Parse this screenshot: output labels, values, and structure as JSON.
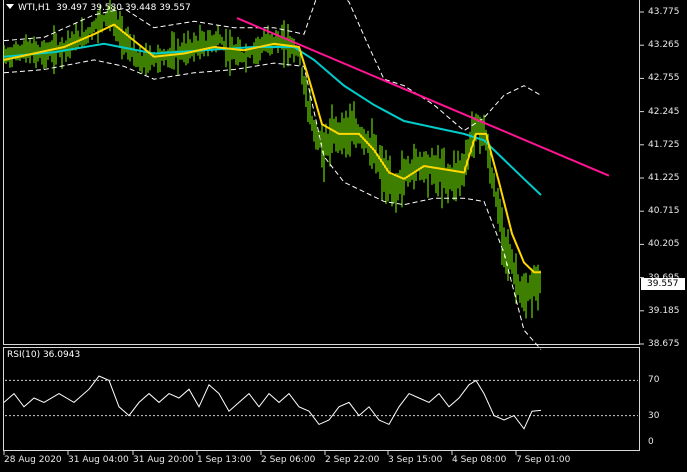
{
  "chart": {
    "symbol": "WTI,H1",
    "ohlc": "39.497 39.580 39.448 39.557",
    "current_price": "39.557",
    "price_ticks": [
      "43.775",
      "43.265",
      "42.755",
      "42.245",
      "41.725",
      "41.225",
      "40.715",
      "40.205",
      "39.695",
      "39.185",
      "38.675"
    ],
    "time_ticks": [
      "28 Aug 2020",
      "31 Aug 04:00",
      "31 Aug 20:00",
      "1 Sep 13:00",
      "2 Sep 06:00",
      "2 Sep 22:00",
      "3 Sep 15:00",
      "4 Sep 08:00",
      "7 Sep 01:00"
    ],
    "colors": {
      "background": "#000000",
      "candles": "#7cfc00",
      "ma_fast": "#ffd700",
      "ma_slow": "#00cccc",
      "envelope": "#ffffff",
      "trendline": "#ff1493",
      "rsi": "#ffffff"
    }
  },
  "rsi": {
    "title": "RSI(10) 36.0943",
    "levels": [
      "70",
      "30",
      "0"
    ]
  },
  "chart_data": {
    "type": "line",
    "title": "WTI,H1 39.497 39.580 39.448 39.557",
    "x_ticks": [
      "28 Aug 2020",
      "31 Aug 04:00",
      "31 Aug 20:00",
      "1 Sep 13:00",
      "2 Sep 06:00",
      "2 Sep 22:00",
      "3 Sep 15:00",
      "4 Sep 08:00",
      "7 Sep 01:00"
    ],
    "ylim": [
      38.6,
      43.9
    ],
    "series": [
      {
        "role": "price",
        "points": [
          [
            0,
            43.05
          ],
          [
            20,
            43.15
          ],
          [
            40,
            43.1
          ],
          [
            60,
            43.2
          ],
          [
            80,
            43.35
          ],
          [
            95,
            43.6
          ],
          [
            105,
            43.7
          ],
          [
            115,
            43.45
          ],
          [
            125,
            43.2
          ],
          [
            135,
            42.95
          ],
          [
            145,
            43.0
          ],
          [
            160,
            43.05
          ],
          [
            175,
            43.1
          ],
          [
            190,
            43.2
          ],
          [
            205,
            43.25
          ],
          [
            215,
            43.35
          ],
          [
            225,
            43.1
          ],
          [
            240,
            43.05
          ],
          [
            255,
            43.2
          ],
          [
            270,
            43.3
          ],
          [
            285,
            43.25
          ],
          [
            295,
            43.1
          ],
          [
            302,
            42.4
          ],
          [
            310,
            41.9
          ],
          [
            320,
            41.6
          ],
          [
            330,
            41.85
          ],
          [
            345,
            41.9
          ],
          [
            360,
            41.8
          ],
          [
            370,
            41.55
          ],
          [
            380,
            41.2
          ],
          [
            390,
            40.95
          ],
          [
            400,
            41.2
          ],
          [
            415,
            41.4
          ],
          [
            430,
            41.3
          ],
          [
            445,
            41.15
          ],
          [
            460,
            41.3
          ],
          [
            470,
            41.95
          ],
          [
            480,
            41.9
          ],
          [
            490,
            41.0
          ],
          [
            500,
            40.2
          ],
          [
            510,
            39.7
          ],
          [
            520,
            39.25
          ],
          [
            530,
            39.5
          ],
          [
            537,
            39.56
          ]
        ]
      },
      {
        "role": "fast-ma",
        "points": [
          [
            0,
            43.0
          ],
          [
            30,
            43.1
          ],
          [
            60,
            43.2
          ],
          [
            90,
            43.4
          ],
          [
            110,
            43.55
          ],
          [
            130,
            43.3
          ],
          [
            150,
            43.05
          ],
          [
            180,
            43.1
          ],
          [
            210,
            43.2
          ],
          [
            240,
            43.15
          ],
          [
            270,
            43.25
          ],
          [
            295,
            43.2
          ],
          [
            305,
            42.7
          ],
          [
            318,
            42.0
          ],
          [
            335,
            41.85
          ],
          [
            355,
            41.85
          ],
          [
            370,
            41.6
          ],
          [
            385,
            41.25
          ],
          [
            400,
            41.15
          ],
          [
            420,
            41.35
          ],
          [
            440,
            41.3
          ],
          [
            460,
            41.25
          ],
          [
            472,
            41.85
          ],
          [
            482,
            41.85
          ],
          [
            495,
            41.1
          ],
          [
            508,
            40.3
          ],
          [
            520,
            39.85
          ],
          [
            530,
            39.7
          ],
          [
            537,
            39.7
          ]
        ]
      },
      {
        "role": "slow-ma",
        "points": [
          [
            0,
            43.05
          ],
          [
            50,
            43.12
          ],
          [
            100,
            43.25
          ],
          [
            150,
            43.1
          ],
          [
            200,
            43.15
          ],
          [
            250,
            43.2
          ],
          [
            290,
            43.2
          ],
          [
            310,
            43.0
          ],
          [
            340,
            42.6
          ],
          [
            370,
            42.3
          ],
          [
            400,
            42.05
          ],
          [
            430,
            41.95
          ],
          [
            460,
            41.85
          ],
          [
            480,
            41.75
          ],
          [
            500,
            41.45
          ],
          [
            520,
            41.15
          ],
          [
            537,
            40.9
          ]
        ]
      },
      {
        "role": "envelope-upper",
        "points": [
          [
            0,
            43.3
          ],
          [
            40,
            43.35
          ],
          [
            90,
            43.7
          ],
          [
            120,
            43.8
          ],
          [
            150,
            43.5
          ],
          [
            190,
            43.6
          ],
          [
            230,
            43.5
          ],
          [
            270,
            43.5
          ],
          [
            300,
            43.4
          ],
          [
            320,
            44.3
          ],
          [
            345,
            43.9
          ],
          [
            365,
            43.2
          ],
          [
            380,
            42.7
          ],
          [
            400,
            42.6
          ],
          [
            430,
            42.3
          ],
          [
            460,
            41.9
          ],
          [
            480,
            42.1
          ],
          [
            500,
            42.45
          ],
          [
            520,
            42.6
          ],
          [
            537,
            42.45
          ]
        ]
      },
      {
        "role": "envelope-lower",
        "points": [
          [
            0,
            42.8
          ],
          [
            40,
            42.85
          ],
          [
            90,
            43.0
          ],
          [
            120,
            42.9
          ],
          [
            150,
            42.7
          ],
          [
            190,
            42.8
          ],
          [
            230,
            42.85
          ],
          [
            270,
            42.95
          ],
          [
            300,
            42.9
          ],
          [
            320,
            41.5
          ],
          [
            340,
            41.1
          ],
          [
            360,
            40.95
          ],
          [
            380,
            40.8
          ],
          [
            400,
            40.75
          ],
          [
            430,
            40.85
          ],
          [
            460,
            40.85
          ],
          [
            480,
            40.8
          ],
          [
            500,
            40.0
          ],
          [
            520,
            38.8
          ],
          [
            537,
            38.5
          ]
        ]
      },
      {
        "role": "trendline",
        "points": [
          [
            233,
            43.65
          ],
          [
            605,
            41.2
          ]
        ]
      },
      {
        "role": "rsi",
        "ylim": [
          0,
          100
        ],
        "points": [
          [
            0,
            45
          ],
          [
            10,
            55
          ],
          [
            20,
            40
          ],
          [
            30,
            50
          ],
          [
            40,
            45
          ],
          [
            55,
            55
          ],
          [
            70,
            45
          ],
          [
            85,
            60
          ],
          [
            95,
            75
          ],
          [
            105,
            70
          ],
          [
            115,
            40
          ],
          [
            125,
            30
          ],
          [
            135,
            45
          ],
          [
            145,
            55
          ],
          [
            155,
            45
          ],
          [
            165,
            55
          ],
          [
            175,
            50
          ],
          [
            185,
            60
          ],
          [
            195,
            40
          ],
          [
            205,
            65
          ],
          [
            215,
            55
          ],
          [
            225,
            35
          ],
          [
            235,
            45
          ],
          [
            245,
            55
          ],
          [
            255,
            40
          ],
          [
            265,
            55
          ],
          [
            275,
            45
          ],
          [
            285,
            55
          ],
          [
            295,
            40
          ],
          [
            305,
            35
          ],
          [
            315,
            20
          ],
          [
            325,
            25
          ],
          [
            335,
            40
          ],
          [
            345,
            45
          ],
          [
            355,
            30
          ],
          [
            365,
            40
          ],
          [
            375,
            25
          ],
          [
            385,
            20
          ],
          [
            395,
            40
          ],
          [
            405,
            55
          ],
          [
            415,
            50
          ],
          [
            425,
            45
          ],
          [
            435,
            55
          ],
          [
            445,
            40
          ],
          [
            455,
            50
          ],
          [
            465,
            65
          ],
          [
            472,
            70
          ],
          [
            480,
            55
          ],
          [
            490,
            30
          ],
          [
            500,
            25
          ],
          [
            510,
            30
          ],
          [
            520,
            15
          ],
          [
            528,
            35
          ],
          [
            537,
            36
          ]
        ]
      }
    ]
  }
}
